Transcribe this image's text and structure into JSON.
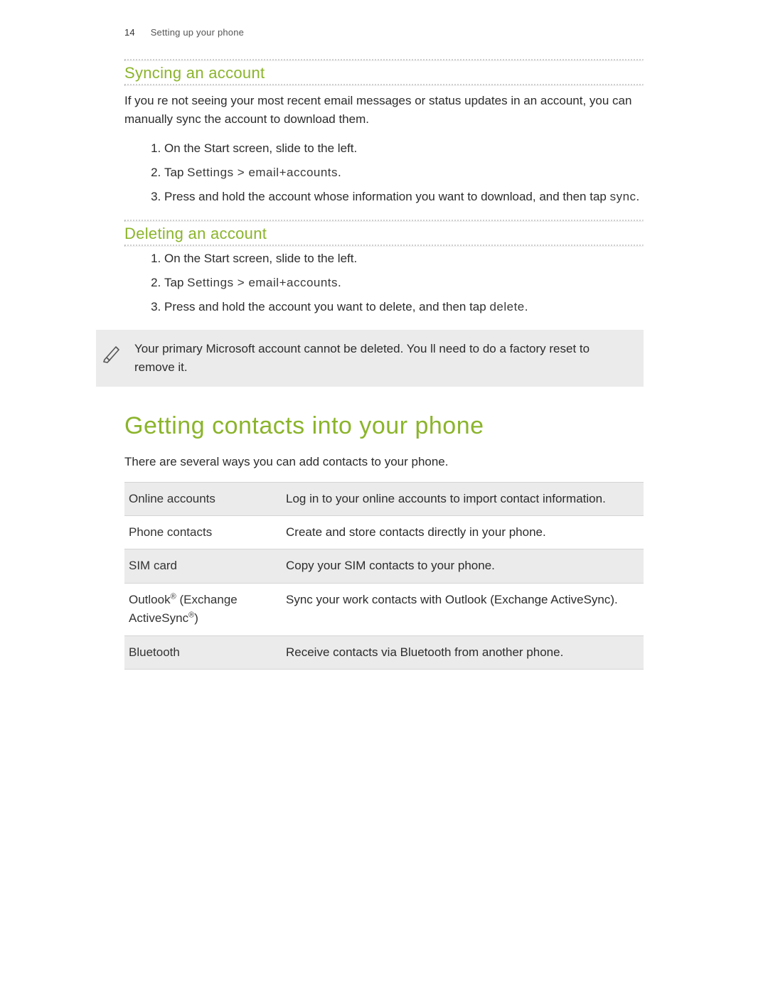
{
  "header": {
    "page_number": "14",
    "section": "Setting up your phone"
  },
  "sync": {
    "heading": "Syncing an account",
    "intro": "If you re not seeing your most recent email messages or status updates in an account, you can manually sync the account to download them.",
    "steps": {
      "s1": "On the Start screen, slide to the left.",
      "s2_prefix": "Tap ",
      "s2_ui": "Settings > email+accounts",
      "s2_suffix": ".",
      "s3_prefix": "Press and hold the account whose information you want to download, and then tap ",
      "s3_ui": "sync",
      "s3_suffix": "."
    }
  },
  "delete": {
    "heading": "Deleting an account",
    "steps": {
      "s1": "On the Start screen, slide to the left.",
      "s2_prefix": "Tap ",
      "s2_ui": "Settings > email+accounts",
      "s2_suffix": ".",
      "s3_prefix": "Press and hold the account you want to delete, and then tap ",
      "s3_ui": "delete",
      "s3_suffix": "."
    },
    "note": "Your primary Microsoft account cannot be deleted. You ll need to do a factory reset to remove it."
  },
  "contacts": {
    "heading": "Getting contacts into your phone",
    "intro": "There are several ways you can add contacts to your phone.",
    "rows": {
      "r0": {
        "k": "Online accounts",
        "v": "Log in to your online accounts to import contact information."
      },
      "r1": {
        "k": "Phone contacts",
        "v": "Create and store contacts directly in your phone."
      },
      "r2": {
        "k": "SIM card",
        "v": "Copy your SIM contacts to your phone."
      },
      "r3_k_prefix": "Outlook",
      "r3_k_mid": " (Exchange ActiveSync",
      "r3_k_suffix": ")",
      "r3_v": "Sync your work contacts with Outlook (Exchange ActiveSync).",
      "r4": {
        "k": "Bluetooth",
        "v": "Receive contacts via Bluetooth from another phone."
      }
    }
  }
}
